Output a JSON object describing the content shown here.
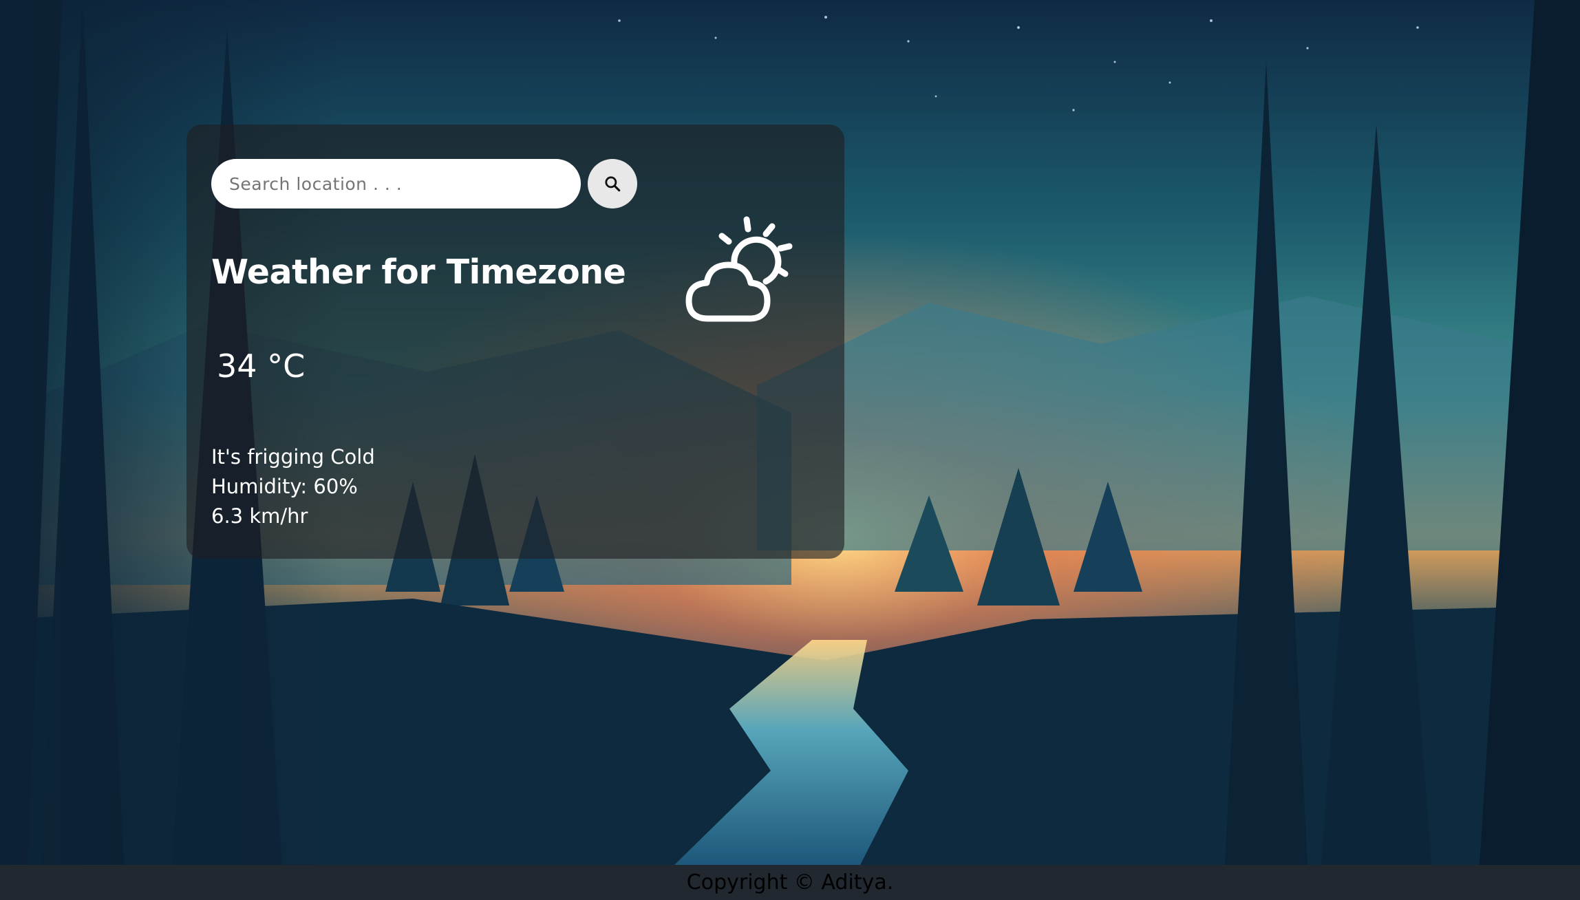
{
  "search": {
    "placeholder": "Search location . . .",
    "value": ""
  },
  "weather": {
    "title_prefix": "Weather for",
    "city": "Timezone",
    "temperature": "34 °C",
    "condition_icon": "partly-cloudy-sun-icon",
    "description": "It's frigging Cold",
    "humidity": "Humidity: 60%",
    "wind": "6.3 km/hr"
  },
  "footer": {
    "copyright": "Copyright © Aditya."
  },
  "icons": {
    "search_button": "search-icon"
  },
  "colors": {
    "card_background": "rgba(30,30,34,0.62)",
    "footer_background": "#212830",
    "text_primary": "#ffffff",
    "footer_text": "#000000"
  }
}
